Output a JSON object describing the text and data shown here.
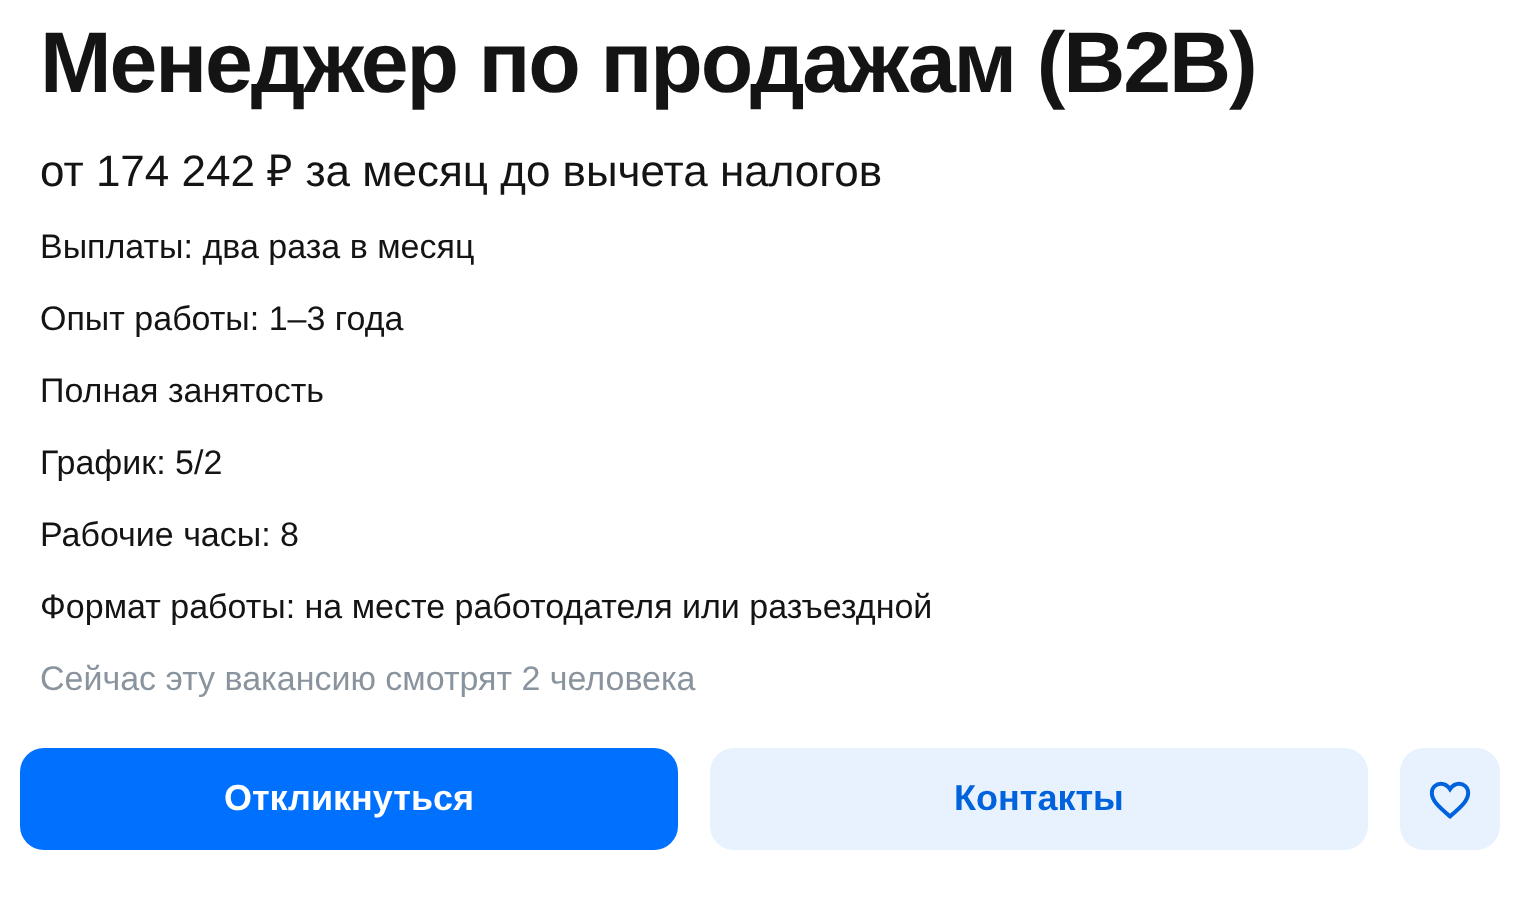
{
  "title": "Менеджер по продажам (B2B)",
  "salary": "от 174 242 ₽ за месяц до вычета налогов",
  "details": [
    "Выплаты: два раза в месяц",
    "Опыт работы: 1–3 года",
    "Полная занятость",
    "График: 5/2",
    "Рабочие часы: 8",
    "Формат работы: на месте работодателя или разъездной"
  ],
  "viewers": "Сейчас эту вакансию смотрят 2 человека",
  "buttons": [
    {
      "kind": "primary",
      "label": "Откликнуться"
    },
    {
      "kind": "secondary",
      "label": "Контакты"
    },
    {
      "kind": "favorite"
    }
  ]
}
